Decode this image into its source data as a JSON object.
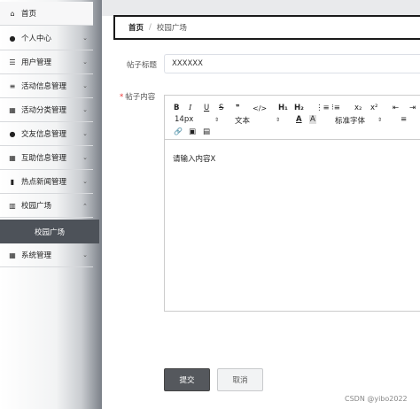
{
  "sidebar": {
    "items": [
      {
        "label": "首页",
        "icon": "home-icon",
        "glyph": "⌂",
        "chevron": false
      },
      {
        "label": "个人中心",
        "icon": "user-icon",
        "glyph": "●",
        "chevron": true
      },
      {
        "label": "用户管理",
        "icon": "list-icon",
        "glyph": "☰",
        "chevron": true
      },
      {
        "label": "活动信息管理",
        "icon": "sliders-icon",
        "glyph": "≡",
        "chevron": true
      },
      {
        "label": "活动分类管理",
        "icon": "grid-icon",
        "glyph": "▦",
        "chevron": true
      },
      {
        "label": "交友信息管理",
        "icon": "user-icon",
        "glyph": "●",
        "chevron": true
      },
      {
        "label": "互助信息管理",
        "icon": "grid-icon",
        "glyph": "▦",
        "chevron": true
      },
      {
        "label": "热点新闻管理",
        "icon": "clipboard-icon",
        "glyph": "▮",
        "chevron": true
      },
      {
        "label": "校园广场",
        "icon": "bar-chart-icon",
        "glyph": "▥",
        "chevron": true
      },
      {
        "label": "系统管理",
        "icon": "grid-icon",
        "glyph": "▦",
        "chevron": true
      }
    ],
    "active_sub": "校园广场",
    "chevron": "⌄"
  },
  "breadcrumb": {
    "home": "首页",
    "separator": "/",
    "current": "校园广场"
  },
  "form": {
    "title_label": "帖子标题",
    "title_value": "XXXXXX",
    "content_label": "帖子内容",
    "required_mark": "*"
  },
  "editor": {
    "toolbar": {
      "bold": "B",
      "italic": "I",
      "underline": "U",
      "strike": "S",
      "quote": "❞",
      "code": "</>",
      "h1": "H₁",
      "h2": "H₂",
      "ordered_list": "⋮≡",
      "bullet_list": "⁝≡",
      "subscript": "x₂",
      "superscript": "x²",
      "outdent": "⇤",
      "indent": "⇥",
      "font_size": "14px",
      "font_size_arrow": "⇕",
      "block_type": "文本",
      "block_type_arrow": "⇕",
      "font_color": "A",
      "background": "A",
      "font_family": "标准字体",
      "font_family_arrow": "⇕",
      "align": "≡",
      "link": "🔗",
      "image": "▣",
      "video": "▤"
    },
    "content": "请输入内容X"
  },
  "actions": {
    "submit": "提交",
    "cancel": "取消"
  },
  "watermark": "CSDN @yibo2022"
}
